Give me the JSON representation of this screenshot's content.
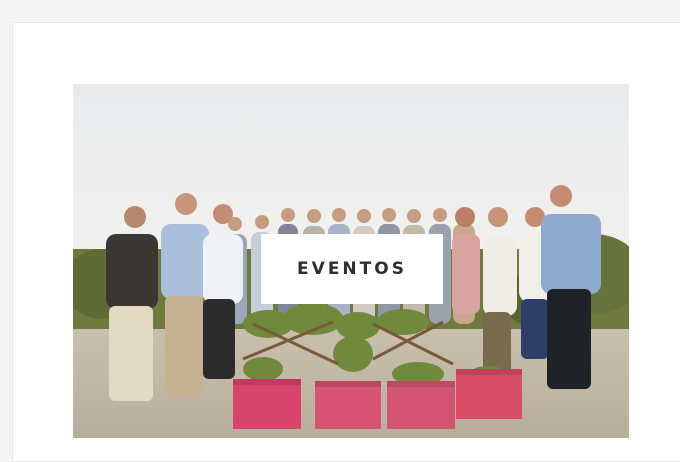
{
  "event_card": {
    "label": "EVENTOS"
  },
  "colors": {
    "page_background": "#f4f4f4",
    "card_background": "#ffffff",
    "label_text": "#2f2f2f",
    "sky": "#eef1f3",
    "planter_pink": "#d9446c"
  }
}
